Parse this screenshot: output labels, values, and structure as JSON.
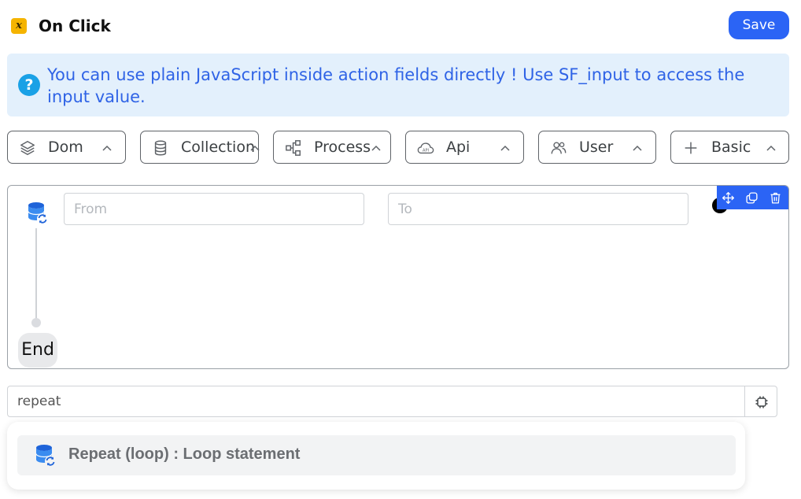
{
  "header": {
    "title": "On Click",
    "icon": "variable-x-icon",
    "save_label": "Save",
    "accent_color": "#2b64f5"
  },
  "info": {
    "icon": "question-circle-icon",
    "text": "You can use plain JavaScript inside action fields directly ! Use SF_input to access the input value."
  },
  "categories": [
    {
      "label": "Dom",
      "icon": "layers-icon"
    },
    {
      "label": "Collection",
      "icon": "database-icon"
    },
    {
      "label": "Process",
      "icon": "flow-nodes-icon"
    },
    {
      "label": "Api",
      "icon": "cloud-api-icon"
    },
    {
      "label": "User",
      "icon": "users-icon"
    },
    {
      "label": "Basic",
      "icon": "plus-icon"
    }
  ],
  "flow": {
    "node_icon": "database-sync-icon",
    "from_placeholder": "From",
    "to_placeholder": "To",
    "end_label": "End",
    "toolbar_icons": [
      "move-icon",
      "copy-icon",
      "trash-icon"
    ]
  },
  "search": {
    "value": "repeat",
    "chip_icon": "cpu-chip-icon"
  },
  "suggestions": [
    {
      "label": "Repeat (loop) : Loop statement",
      "icon": "database-sync-icon"
    }
  ]
}
